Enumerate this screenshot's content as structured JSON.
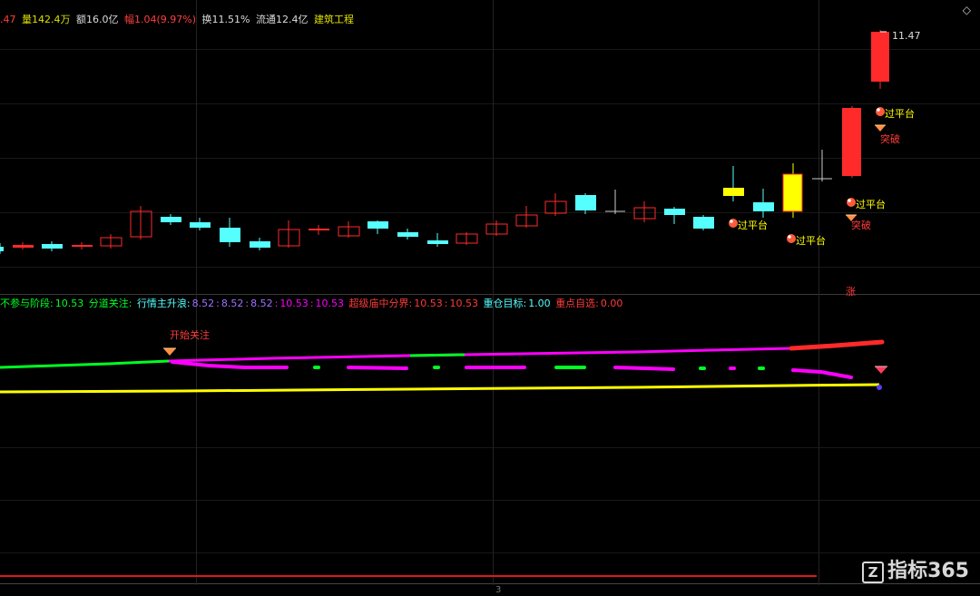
{
  "infobar": {
    "last": ".47",
    "vol_label": "量",
    "vol": "142.4万",
    "amt_label": "额",
    "amt": "16.0亿",
    "chg_label": "幅",
    "chg": "1.04(9.97%)",
    "turn_label": "换",
    "turn": "11.51%",
    "float_label": "流通",
    "float": "12.4亿",
    "sector": "建筑工程"
  },
  "high_label": "11.47",
  "corner_icon": "diamond-outline",
  "signals": {
    "guopingtai": "过平台",
    "tupo": "突破",
    "zhang": "涨"
  },
  "indicator": {
    "a_label": "不参与阶段:",
    "a_val": "10.53",
    "b_label": "分道关注:",
    "c_label": "行情主升浪:",
    "c_vals": [
      "8.52",
      "8.52",
      "8.52"
    ],
    "d_vals": [
      "10.53",
      "10.53"
    ],
    "e_label": "超级庙中分界:",
    "e_vals": [
      "10.53",
      "10.53"
    ],
    "f_label": "重仓目标:",
    "f_val": "1.00",
    "g_label": "重点自选:",
    "g_val": "0.00"
  },
  "annotation": "开始关注",
  "watermark": {
    "logo": "Z",
    "text": "指标365"
  },
  "bottom_tick": "3",
  "colors": {
    "up": "#ff2a2a",
    "down": "#55ffff",
    "yellow": "#ffff00",
    "green": "#00ff22",
    "magenta": "#ff00ff",
    "bg": "#000000"
  }
}
